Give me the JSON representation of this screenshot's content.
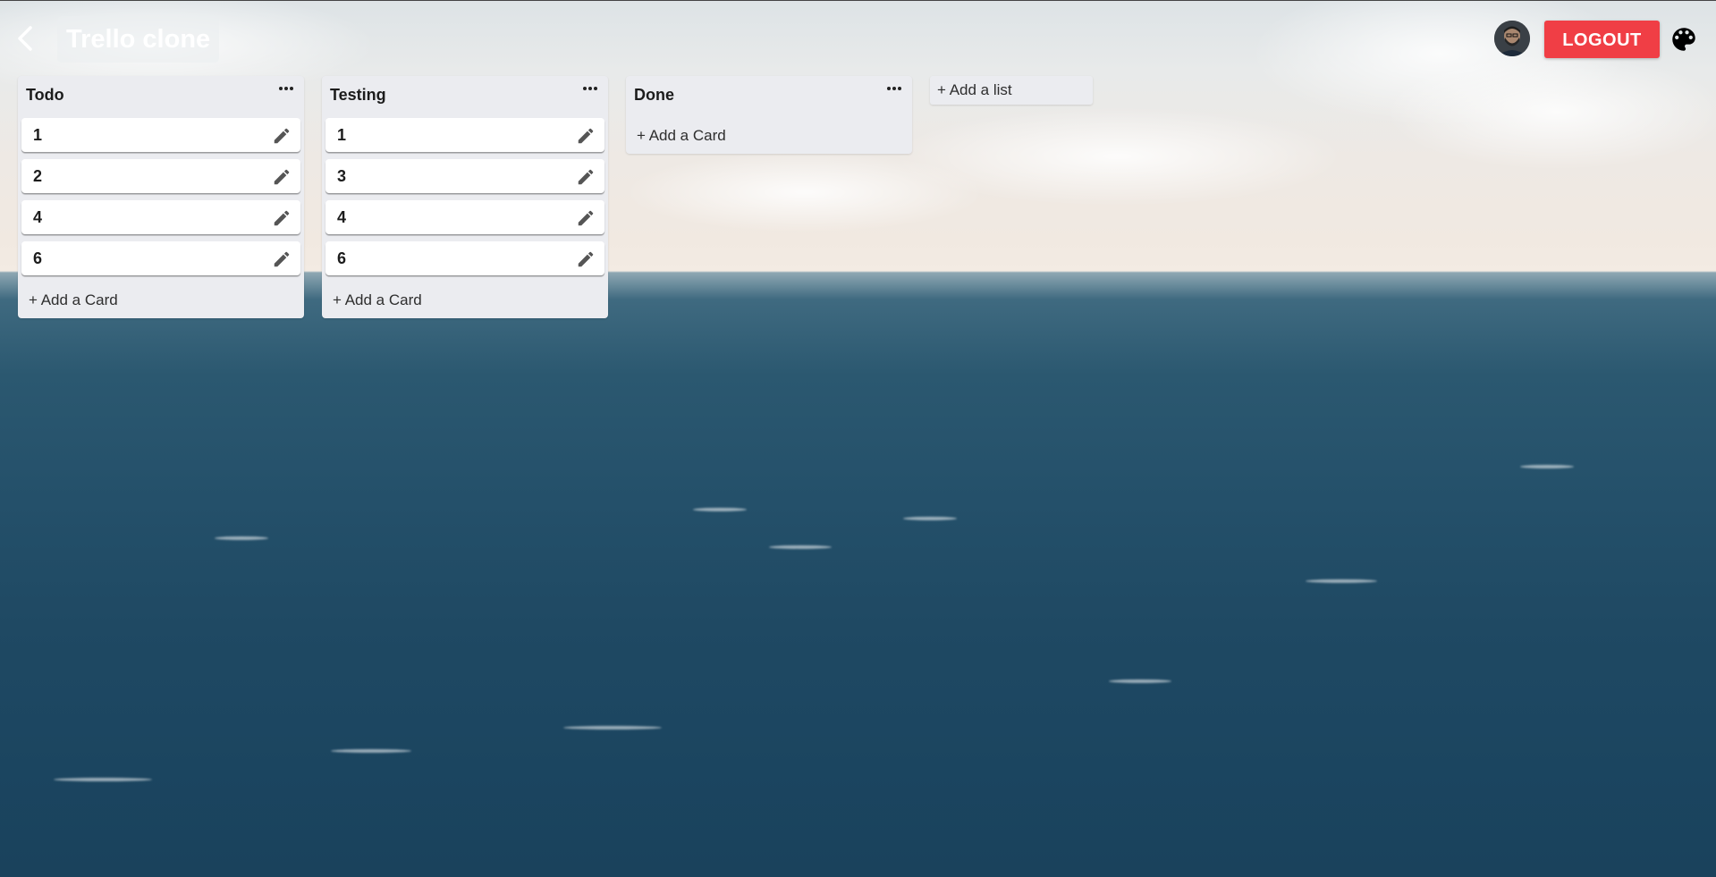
{
  "header": {
    "board_title": "Trello clone",
    "logout_label": "LOGOUT"
  },
  "lists": [
    {
      "title": "Todo",
      "cards": [
        "1",
        "2",
        "4",
        "6"
      ],
      "add_card_label": "+ Add a Card"
    },
    {
      "title": "Testing",
      "cards": [
        "1",
        "3",
        "4",
        "6"
      ],
      "add_card_label": "+ Add a Card"
    },
    {
      "title": "Done",
      "cards": [],
      "add_card_label": "+ Add a Card"
    }
  ],
  "add_list_label": "+ Add a list",
  "icons": {
    "back": "chevron-left-icon",
    "list_menu": "more-horizontal-icon",
    "edit": "pencil-icon",
    "palette": "palette-icon"
  },
  "colors": {
    "logout": "#f03e45",
    "list_bg": "#ebecf0",
    "card_bg": "#ffffff"
  }
}
